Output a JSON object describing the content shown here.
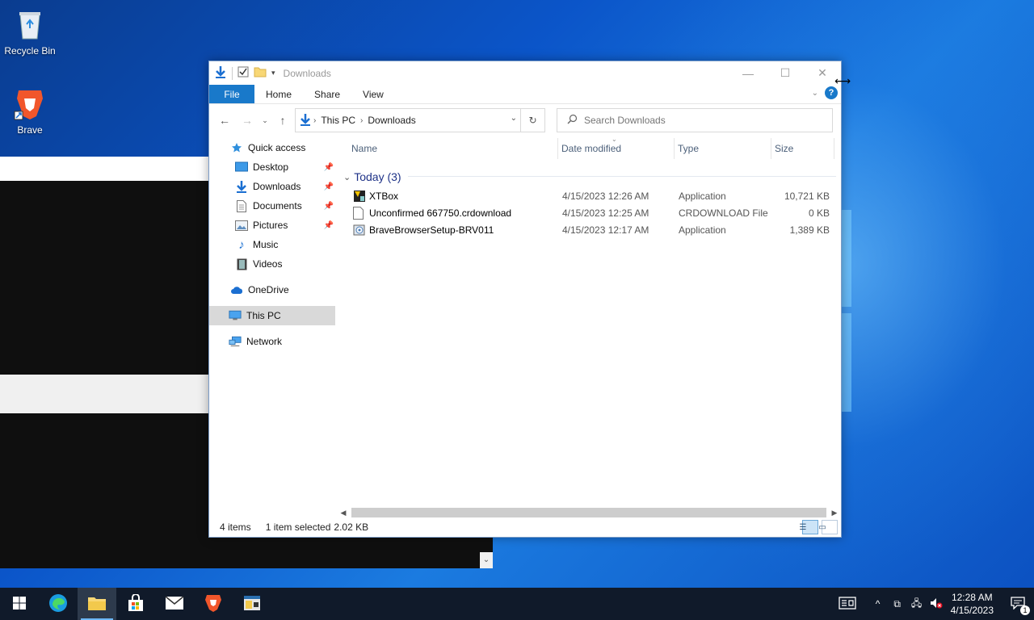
{
  "desktop": {
    "icons": [
      {
        "label": "Recycle Bin"
      },
      {
        "label": "Brave"
      }
    ]
  },
  "window": {
    "title": "Downloads",
    "ribbon_tabs": [
      "File",
      "Home",
      "Share",
      "View"
    ],
    "address": {
      "crumbs": [
        "This PC",
        "Downloads"
      ]
    },
    "search": {
      "placeholder": "Search Downloads"
    },
    "nav": {
      "quick_access": "Quick access",
      "items": [
        {
          "label": "Desktop",
          "pinned": true
        },
        {
          "label": "Downloads",
          "pinned": true
        },
        {
          "label": "Documents",
          "pinned": true
        },
        {
          "label": "Pictures",
          "pinned": true
        },
        {
          "label": "Music",
          "pinned": false
        },
        {
          "label": "Videos",
          "pinned": false
        }
      ],
      "onedrive": "OneDrive",
      "this_pc": "This PC",
      "network": "Network"
    },
    "columns": {
      "name": "Name",
      "date": "Date modified",
      "type": "Type",
      "size": "Size"
    },
    "group": "Today (3)",
    "files": [
      {
        "name": "XTBox",
        "date": "4/15/2023 12:26 AM",
        "type": "Application",
        "size": "10,721 KB"
      },
      {
        "name": "Unconfirmed 667750.crdownload",
        "date": "4/15/2023 12:25 AM",
        "type": "CRDOWNLOAD File",
        "size": "0 KB"
      },
      {
        "name": "BraveBrowserSetup-BRV011",
        "date": "4/15/2023 12:17 AM",
        "type": "Application",
        "size": "1,389 KB"
      }
    ],
    "status": {
      "items": "4 items",
      "selected": "1 item selected",
      "size": "2.02 KB"
    }
  },
  "taskbar": {
    "clock_time": "12:28 AM",
    "clock_date": "4/15/2023",
    "notification_count": "1"
  }
}
